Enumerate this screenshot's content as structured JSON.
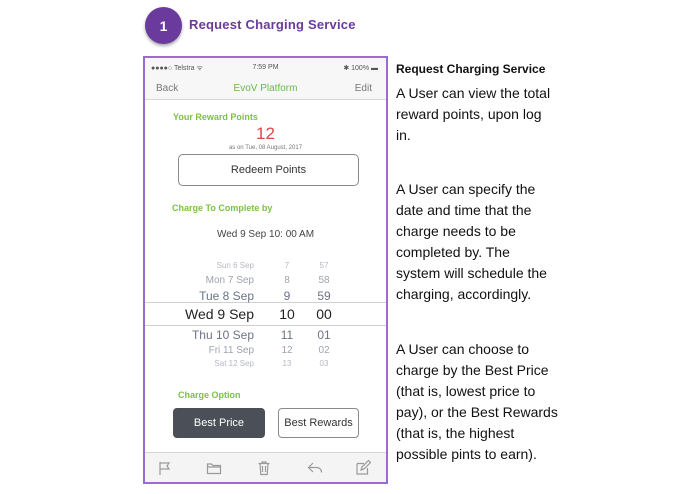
{
  "step": {
    "number": "1",
    "title": "Request Charging Service"
  },
  "phone": {
    "status": {
      "carrier": "●●●●○ Telstra ᯤ",
      "time": "7:59 PM",
      "battery": "✱ 100% ▬"
    },
    "nav": {
      "back": "Back",
      "title": "EvoV Platform",
      "edit": "Edit"
    },
    "rewards": {
      "label": "Your Reward Points",
      "value": "12",
      "as_of": "as on Tue, 08 August, 2017",
      "redeem_label": "Redeem Points"
    },
    "complete_by": {
      "label": "Charge To Complete by",
      "value": "Wed 9 Sep 10: 00 AM"
    },
    "picker": {
      "rows": [
        {
          "day": "Sun 6 Sep",
          "hour": "7",
          "minute": "57"
        },
        {
          "day": "Mon 7 Sep",
          "hour": "8",
          "minute": "58"
        },
        {
          "day": "Tue 8 Sep",
          "hour": "9",
          "minute": "59"
        },
        {
          "day": "Wed 9 Sep",
          "hour": "10",
          "minute": "00"
        },
        {
          "day": "Thu 10 Sep",
          "hour": "11",
          "minute": "01"
        },
        {
          "day": "Fri 11 Sep",
          "hour": "12",
          "minute": "02"
        },
        {
          "day": "Sat 12 Sep",
          "hour": "13",
          "minute": "03"
        }
      ]
    },
    "charge_option": {
      "label": "Charge Option",
      "best_price": "Best Price",
      "best_rewards": "Best Rewards"
    },
    "toolbar": [
      "flag-icon",
      "folder-icon",
      "trash-icon",
      "reply-icon",
      "compose-icon"
    ]
  },
  "description": {
    "title": "Request Charging Service",
    "p1": [
      "A User can view the total",
      "reward points, upon log",
      "in."
    ],
    "p2": [
      "A User can specify the",
      "date and time that the",
      "charge needs to be",
      "completed by. The",
      "system will schedule the",
      "charging, accordingly."
    ],
    "p3": [
      "A User can choose to",
      "charge by the Best Price",
      "(that is, lowest price to",
      "pay), or the Best Rewards",
      "(that is, the highest",
      "possible pints to earn)."
    ]
  },
  "colors": {
    "accent_purple": "#6a3a9c",
    "green": "#7cc242",
    "red": "#e0454a",
    "dark_button": "#4a4f58"
  }
}
